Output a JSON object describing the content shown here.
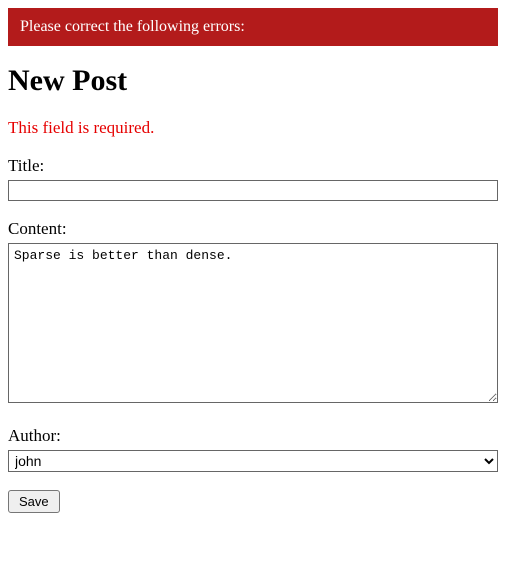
{
  "error_banner": "Please correct the following errors:",
  "heading": "New Post",
  "field_error": "This field is required.",
  "form": {
    "title": {
      "label": "Title:",
      "value": ""
    },
    "content": {
      "label": "Content:",
      "value": "Sparse is better than dense."
    },
    "author": {
      "label": "Author:",
      "selected": "john"
    },
    "save_label": "Save"
  }
}
